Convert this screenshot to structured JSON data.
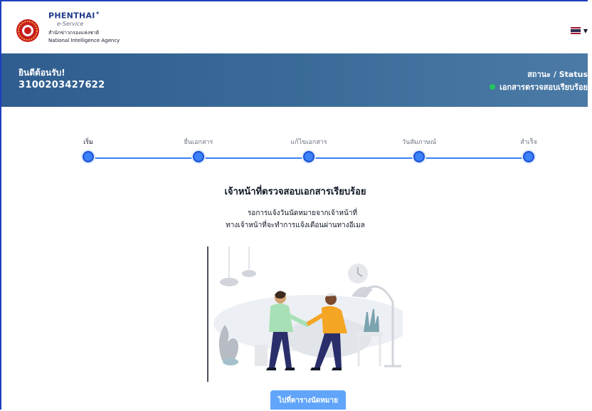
{
  "header": {
    "brand_name": "PHENTHAI",
    "brand_sub": "e-Service",
    "org_thai": "สำนักข่าวกรองแห่งชาติ",
    "org_en": "National Intelligence Agency",
    "logo_icon": "nia-emblem-icon",
    "lang_flag_colors": [
      "#a51931",
      "#f4f5f8",
      "#2d2a4a",
      "#f4f5f8",
      "#a51931"
    ]
  },
  "banner": {
    "welcome": "ยินดีต้อนรับ!",
    "id_number": "3100203427622",
    "status_label": "สถานะ / Status",
    "status_value": "เอกสารตรวจสอบเรียบร้อย",
    "status_color": "#22c55e"
  },
  "stepper": {
    "steps": [
      {
        "label": "เริ่ม"
      },
      {
        "label": "ยื่นเอกสาร"
      },
      {
        "label": "แก้ไขเอกสาร"
      },
      {
        "label": "วันสัมภาษณ์"
      },
      {
        "label": "สำเร็จ"
      }
    ],
    "accent": "#3b82f6"
  },
  "content": {
    "title": "เจ้าหน้าที่ตรวจสอบเอกสารเรียบร้อย",
    "message_line1": "รอการแจ้งวันนัดหมายจากเจ้าหน้าที่",
    "message_line2": "ทางเจ้าหน้าที่จะทำการแจ้งเตือนผ่านทางอีเมล",
    "illustration_icon": "handshake-illustration-icon"
  },
  "cta": {
    "label": "ไปที่ตารางนัดหมาย"
  }
}
